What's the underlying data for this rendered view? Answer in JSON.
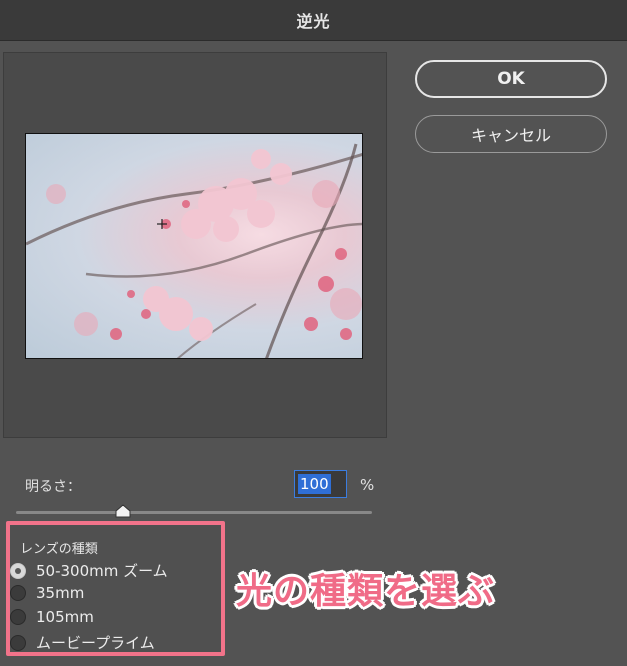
{
  "window": {
    "title": "逆光"
  },
  "buttons": {
    "ok": "OK",
    "cancel": "キャンセル"
  },
  "brightness": {
    "label": "明るさ：",
    "value": "100",
    "unit": "%",
    "level": 0.3
  },
  "lens": {
    "title": "レンズの種類",
    "options": [
      {
        "label": "50-300mm ズーム",
        "selected": true
      },
      {
        "label": "35mm",
        "selected": false
      },
      {
        "label": "105mm",
        "selected": false
      },
      {
        "label": "ムービープライム",
        "selected": false
      }
    ]
  },
  "annotation": {
    "text": "光の種類を選ぶ",
    "color": "#f06b87"
  },
  "colors": {
    "accent": "#3b7de0",
    "highlight_border": "#f2738a",
    "dialog_bg": "#535353"
  }
}
